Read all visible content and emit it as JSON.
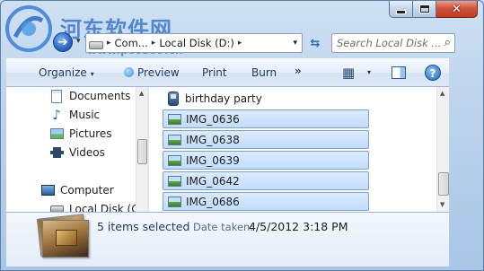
{
  "watermark": {
    "title": "河东软件网",
    "url": "www.pc0359.cn"
  },
  "window": {
    "minimize_icon": "minimize-icon",
    "maximize_icon": "maximize-icon",
    "close_icon": "close-icon",
    "close_glyph": "✕"
  },
  "address_bar": {
    "back_glyph": "➔",
    "breadcrumbs": [
      "Com...",
      "Local Disk (D:)"
    ],
    "separator": "▸",
    "dropdown_glyph": "▾",
    "refresh_glyph": "⇆"
  },
  "search": {
    "placeholder": "Search Local Disk ...",
    "icon_glyph": "⌕"
  },
  "toolbar": {
    "organize_label": "Organize",
    "preview_label": "Preview",
    "print_label": "Print",
    "burn_label": "Burn",
    "more_label": "»",
    "caret": "▾",
    "views_glyph": "▦",
    "help_glyph": "?"
  },
  "nav_pane": {
    "items": [
      {
        "label": "Documents",
        "icon": "documents-icon"
      },
      {
        "label": "Music",
        "icon": "music-icon"
      },
      {
        "label": "Pictures",
        "icon": "pictures-icon"
      },
      {
        "label": "Videos",
        "icon": "videos-icon"
      },
      {
        "label": "Computer",
        "icon": "computer-icon"
      },
      {
        "label": "Local Disk (C:",
        "icon": "disk-icon"
      }
    ],
    "music_glyph": "♪"
  },
  "files": [
    {
      "name": "birthday party",
      "selected": false,
      "icon": "device-icon"
    },
    {
      "name": "IMG_0636",
      "selected": true,
      "icon": "image-icon"
    },
    {
      "name": "IMG_0638",
      "selected": true,
      "icon": "image-icon"
    },
    {
      "name": "IMG_0639",
      "selected": true,
      "icon": "image-icon"
    },
    {
      "name": "IMG_0642",
      "selected": true,
      "icon": "image-icon"
    },
    {
      "name": "IMG_0686",
      "selected": true,
      "icon": "image-icon"
    }
  ],
  "scroll": {
    "up_glyph": "▲",
    "down_glyph": "▼"
  },
  "details": {
    "selection_count": "5 items selected",
    "date_label": "Date taken:",
    "date_value": "4/5/2012 3:18 PM"
  },
  "colors": {
    "selection_fill": "#c1dcfb",
    "selection_border": "#7da2ce",
    "watermark_blue": "#3c78c8"
  }
}
